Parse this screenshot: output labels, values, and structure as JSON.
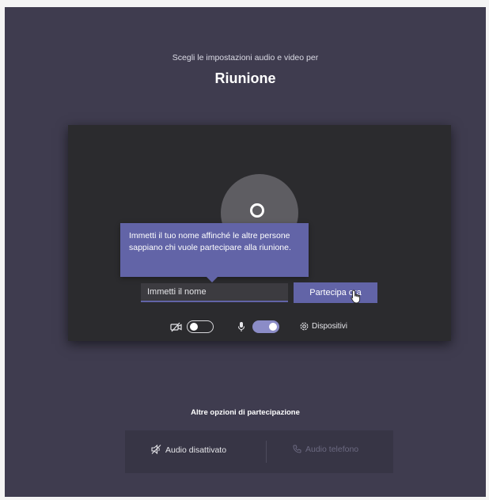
{
  "header": {
    "subtitle": "Scegli le impostazioni audio e video per",
    "meeting_title": "Riunione"
  },
  "preview": {
    "tooltip_text": "Immetti il tuo nome affinché le altre persone sappiano chi vuole partecipare alla riunione.",
    "name_input": {
      "placeholder": "Immetti il nome",
      "value": ""
    },
    "join_button_label": "Partecipa ora",
    "controls": {
      "camera": {
        "on": false
      },
      "microphone": {
        "on": true
      },
      "devices_label": "Dispositivi"
    }
  },
  "other_options": {
    "heading": "Altre opzioni di partecipazione",
    "audio_off_label": "Audio disattivato",
    "phone_audio_label": "Audio telefono"
  },
  "colors": {
    "background": "#3f3c4f",
    "card": "#2b2b2e",
    "accent": "#6264a7",
    "toggle_on": "#8b8cc7"
  },
  "icons": [
    "avatar-placeholder",
    "camera-off-icon",
    "microphone-icon",
    "gear-icon",
    "speaker-off-icon",
    "phone-icon",
    "mouse-pointer-icon"
  ]
}
